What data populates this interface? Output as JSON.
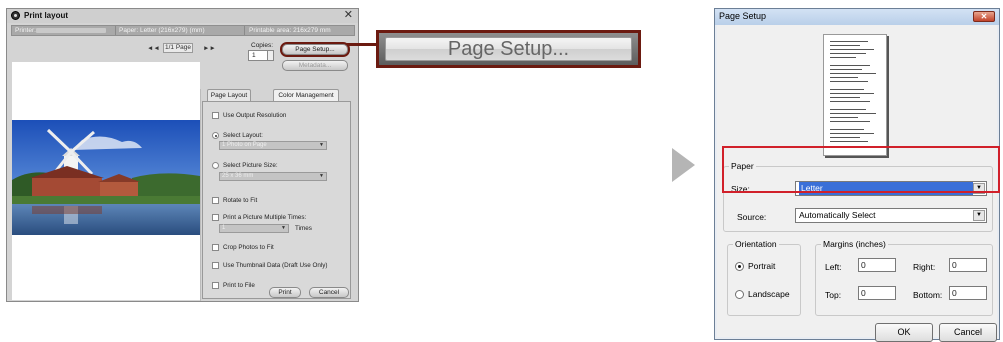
{
  "print_layout": {
    "title": "Print layout",
    "close_glyph": "✕",
    "printer_label": "Printer:",
    "paper_label": "Paper: Letter (216x279) (mm)",
    "printable_area": "Printable area: 216x279 mm",
    "pager": {
      "prev": "◄◄",
      "page": "1/1 Page",
      "next": "►►"
    },
    "copies_label": "Copies:",
    "copies_value": "1",
    "page_setup_label": "Page Setup...",
    "metadata_label": "Metadata...",
    "tabs": [
      "Page Layout",
      "Color Management"
    ],
    "options": {
      "use_output_resolution": "Use Output Resolution",
      "select_layout": "Select Layout:",
      "layout_value": "1 Photo on Page",
      "select_picture_size": "Select Picture Size:",
      "picture_size_value": "25 x 36 mm",
      "rotate_to_fit": "Rotate to Fit",
      "print_multiple": "Print a Picture Multiple Times:",
      "multiple_value": "1",
      "times": "Times",
      "crop_photos": "Crop Photos to Fit",
      "use_thumbnail": "Use Thumbnail Data (Draft Use Only)",
      "print_to_file": "Print to File"
    },
    "print_label": "Print",
    "cancel_label": "Cancel"
  },
  "callout": {
    "label": "Page Setup..."
  },
  "page_setup": {
    "title": "Page Setup",
    "close_glyph": "✕",
    "paper_group": "Paper",
    "size_label": "Size:",
    "size_value": "Letter",
    "source_label": "Source:",
    "source_value": "Automatically Select",
    "orientation_group": "Orientation",
    "portrait_label": "Portrait",
    "landscape_label": "Landscape",
    "margins_group": "Margins (inches)",
    "left_label": "Left:",
    "left_value": "0",
    "right_label": "Right:",
    "right_value": "0",
    "top_label": "Top:",
    "top_value": "0",
    "bottom_label": "Bottom:",
    "bottom_value": "0",
    "ok_label": "OK",
    "cancel_label": "Cancel",
    "dropdown_glyph": "▼"
  },
  "colors": {
    "callout_border": "#6b1a10",
    "highlight_red": "#d1202a",
    "selection_blue": "#3a6fd8"
  }
}
